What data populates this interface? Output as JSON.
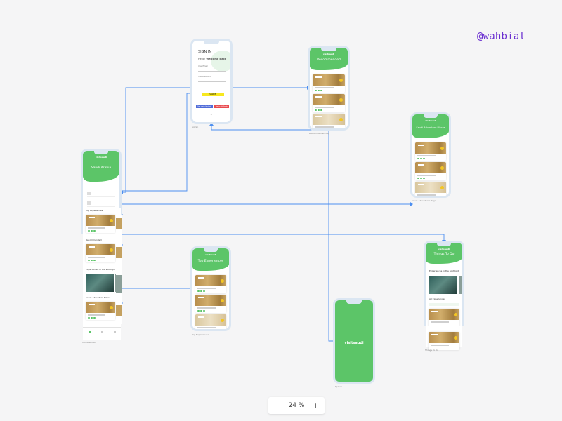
{
  "author_handle": "@wahbiat",
  "zoom": {
    "minus": "−",
    "value": "24 %",
    "plus": "+"
  },
  "frames": {
    "signin": {
      "label": "Signin",
      "title": "SIGN IN",
      "welcome_prefix": "Hello!",
      "welcome": "Welcome Back",
      "field1": "User Email",
      "field2": "Your Password",
      "cta": "SIGN IN",
      "btn_a": "Sign in with Facebook",
      "btn_b": "Sign in with Google",
      "footer": "or"
    },
    "recommended": {
      "label": "Recommended Exp",
      "brand": "visitsaudi",
      "title": "Recommended"
    },
    "saudi_adventure": {
      "label": "Saudi Adventures Page",
      "brand": "visitsaudi",
      "title": "Saudi Adventure Places"
    },
    "home": {
      "label": "Home screen",
      "brand": "visitsaudi",
      "title": "Saudi Arabia",
      "section1": "Top Experiences",
      "section2": "Recommended",
      "section3": "Experiences in the spotlight",
      "section4": "Saudi Adventure Places"
    },
    "top_experiences": {
      "label": "Top Experiences",
      "brand": "visitsaudi",
      "title": "Top Experiences"
    },
    "splash": {
      "label": "Splash",
      "logo": "visitsaudi"
    },
    "things": {
      "label": "Things To Do",
      "brand": "visitsaudi",
      "title": "Things To Do",
      "section1": "Experiences in the spotlight",
      "section2": "All Experiences"
    }
  },
  "colors": {
    "brand_green": "#5cc568",
    "wire_blue": "#4d8ff0",
    "cta_yellow": "#f7e81f",
    "handle_purple": "#6a2fd0"
  }
}
